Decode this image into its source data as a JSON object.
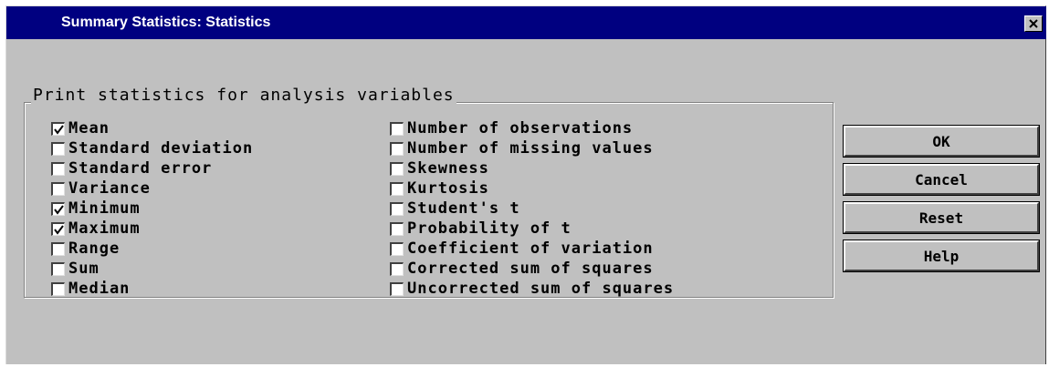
{
  "window": {
    "title": "Summary Statistics: Statistics"
  },
  "group": {
    "legend": "Print statistics for analysis variables"
  },
  "statistics_left": [
    {
      "label": "Mean",
      "checked": true
    },
    {
      "label": "Standard deviation",
      "checked": false
    },
    {
      "label": "Standard error",
      "checked": false
    },
    {
      "label": "Variance",
      "checked": false
    },
    {
      "label": "Minimum",
      "checked": true
    },
    {
      "label": "Maximum",
      "checked": true
    },
    {
      "label": "Range",
      "checked": false
    },
    {
      "label": "Sum",
      "checked": false
    },
    {
      "label": "Median",
      "checked": false
    }
  ],
  "statistics_right": [
    {
      "label": "Number of observations",
      "checked": false
    },
    {
      "label": "Number of missing values",
      "checked": false
    },
    {
      "label": "Skewness",
      "checked": false
    },
    {
      "label": "Kurtosis",
      "checked": false
    },
    {
      "label": "Student's t",
      "checked": false
    },
    {
      "label": "Probability of t",
      "checked": false
    },
    {
      "label": "Coefficient of variation",
      "checked": false
    },
    {
      "label": "Corrected sum of squares",
      "checked": false
    },
    {
      "label": "Uncorrected sum of squares",
      "checked": false
    }
  ],
  "buttons": {
    "ok": "OK",
    "cancel": "Cancel",
    "reset": "Reset",
    "help": "Help"
  },
  "colors": {
    "titlebar": "#000080",
    "dialog": "#c0c0c0"
  }
}
